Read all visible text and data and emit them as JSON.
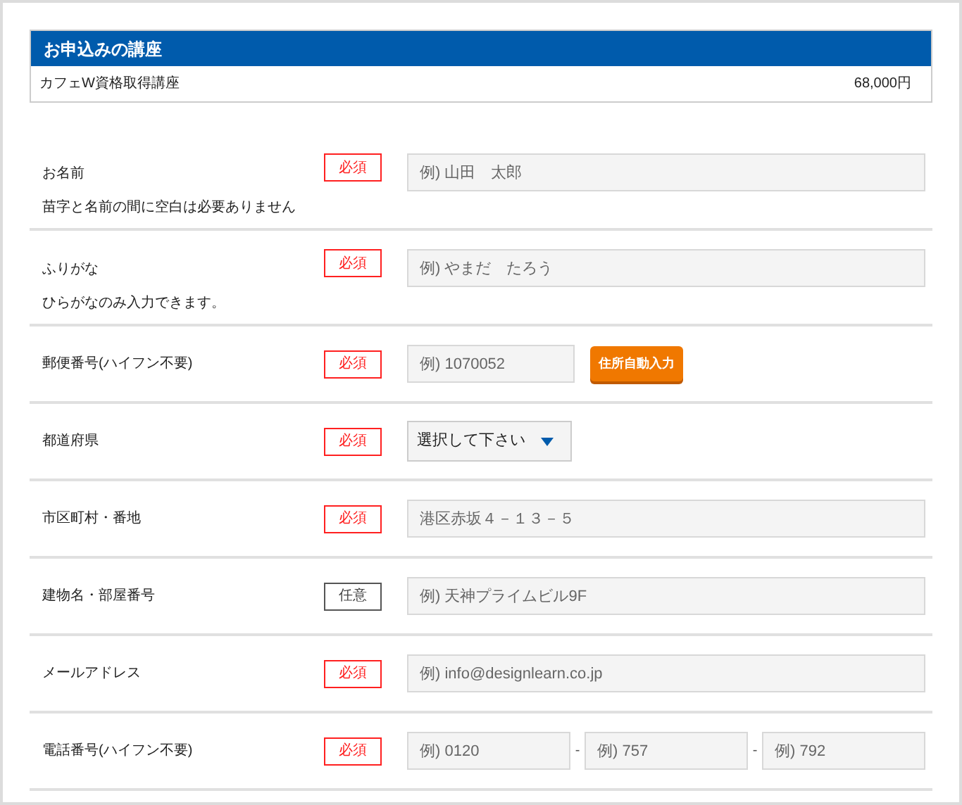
{
  "course_section": {
    "title": "お申込みの講座",
    "course": {
      "name": "カフェW資格取得講座",
      "price": "68,000円"
    }
  },
  "form_rows": [
    {
      "kind": "text",
      "label": "お名前",
      "note": "苗字と名前の間に空白は必要ありません",
      "required": true,
      "badge": "必須",
      "placeholder": "例) 山田　太郎"
    },
    {
      "kind": "text",
      "label": "ふりがな",
      "note": "ひらがなのみ入力できます。",
      "required": true,
      "badge": "必須",
      "placeholder": "例) やまだ　たろう"
    },
    {
      "kind": "zip",
      "label": "郵便番号(ハイフン不要)",
      "required": true,
      "badge": "必須",
      "placeholder": "例) 1070052",
      "button": "住所自動入力"
    },
    {
      "kind": "select",
      "label": "都道府県",
      "required": true,
      "badge": "必須",
      "value": "選択して下さい"
    },
    {
      "kind": "text",
      "label": "市区町村・番地",
      "required": true,
      "badge": "必須",
      "placeholder": "港区赤坂４－１３－５"
    },
    {
      "kind": "text",
      "label": "建物名・部屋番号",
      "required": false,
      "badge": "任意",
      "placeholder": "例) 天神プライムビル9F"
    },
    {
      "kind": "text",
      "label": "メールアドレス",
      "required": true,
      "badge": "必須",
      "placeholder": "例) info@designlearn.co.jp"
    },
    {
      "kind": "phone",
      "label": "電話番号(ハイフン不要)",
      "required": true,
      "badge": "必須",
      "parts": [
        {
          "placeholder": "例) 0120"
        },
        {
          "separator": "-",
          "placeholder": "例) 757"
        },
        {
          "separator": "-",
          "placeholder": "例) 792"
        }
      ]
    }
  ]
}
